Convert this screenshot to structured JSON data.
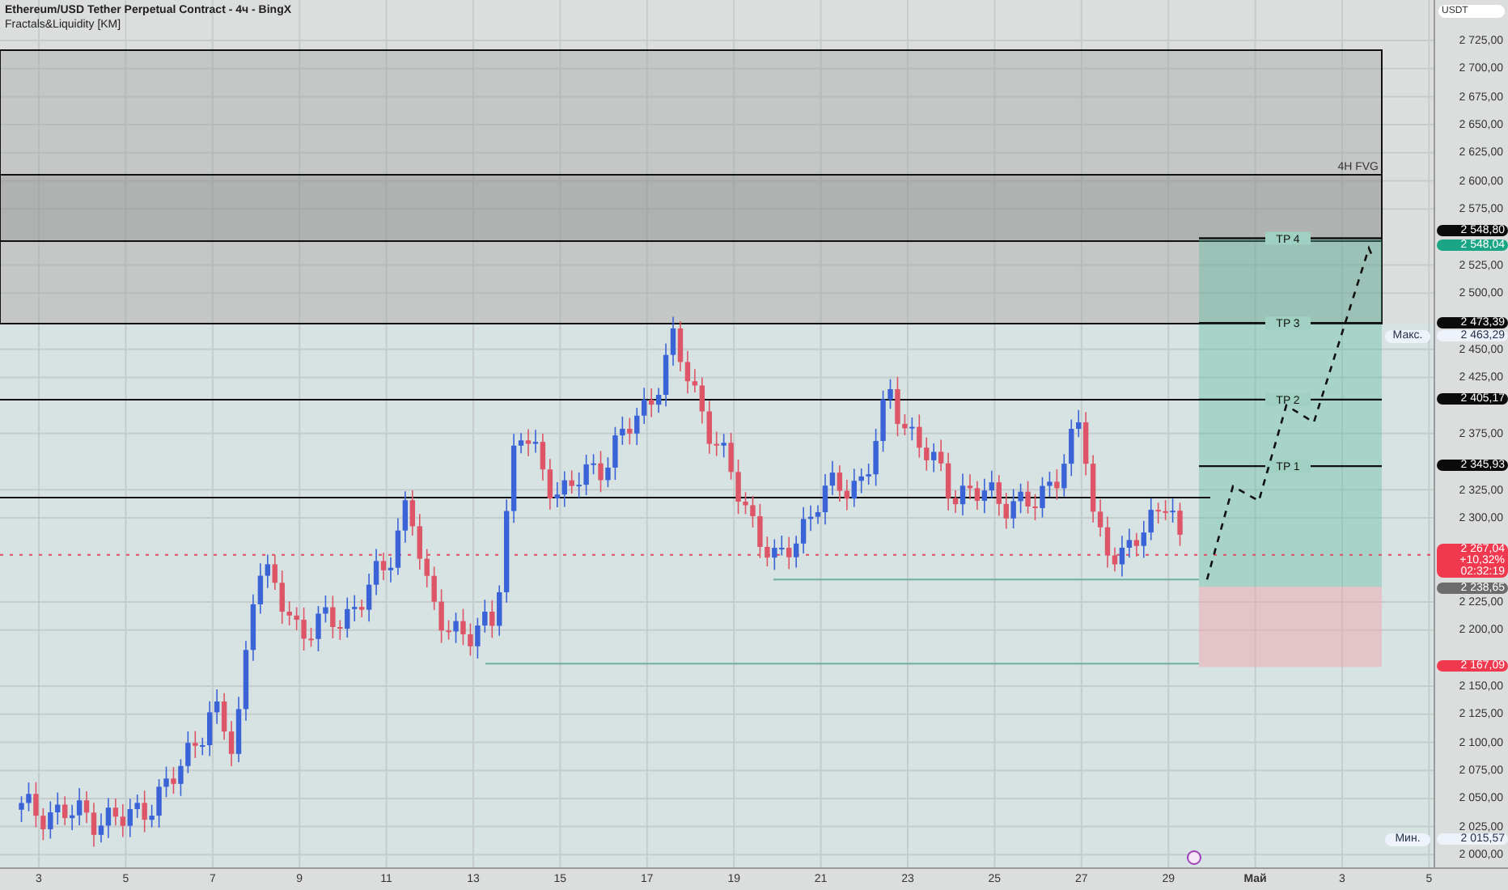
{
  "header": {
    "title": "Ethereum/USD Tether Perpetual Contract - 4ч - BingX",
    "indicator": "Fractals&Liquidity [KM]"
  },
  "price_axis": {
    "currency": "USDT",
    "ticks": [
      "2 725,00",
      "2 700,00",
      "2 675,00",
      "2 650,00",
      "2 625,00",
      "2 600,00",
      "2 575,00",
      "2 525,00",
      "2 500,00",
      "2 450,00",
      "2 425,00",
      "2 375,00",
      "2 325,00",
      "2 300,00",
      "2 225,00",
      "2 200,00",
      "2 150,00",
      "2 125,00",
      "2 100,00",
      "2 075,00",
      "2 050,00",
      "2 025,00",
      "2 000,00"
    ],
    "badges": [
      {
        "text": "2 548,80",
        "kind": "level"
      },
      {
        "text": "2 548,04",
        "kind": "target"
      },
      {
        "text": "2 473,39",
        "kind": "level"
      },
      {
        "text": "2 463,29",
        "kind": "extreme",
        "label": "Макс."
      },
      {
        "text": "2 405,17",
        "kind": "level"
      },
      {
        "text": "2 345,93",
        "kind": "level"
      },
      {
        "text": "2 267,04",
        "kind": "last",
        "lines": [
          "+10,32%",
          "02:32:19"
        ]
      },
      {
        "text": "2 238,65",
        "kind": "entry"
      },
      {
        "text": "2 167,09",
        "kind": "stop"
      },
      {
        "text": "2 015,57",
        "kind": "extreme",
        "label": "Мин."
      }
    ]
  },
  "chart": {
    "zone_label": "4H FVG",
    "targets": [
      "TP 4",
      "TP 3",
      "TP 2",
      "TP 1"
    ]
  },
  "time_axis": {
    "labels": [
      "3",
      "5",
      "7",
      "9",
      "11",
      "13",
      "15",
      "17",
      "19",
      "21",
      "23",
      "25",
      "27",
      "29",
      "Май",
      "3",
      "5"
    ]
  }
}
